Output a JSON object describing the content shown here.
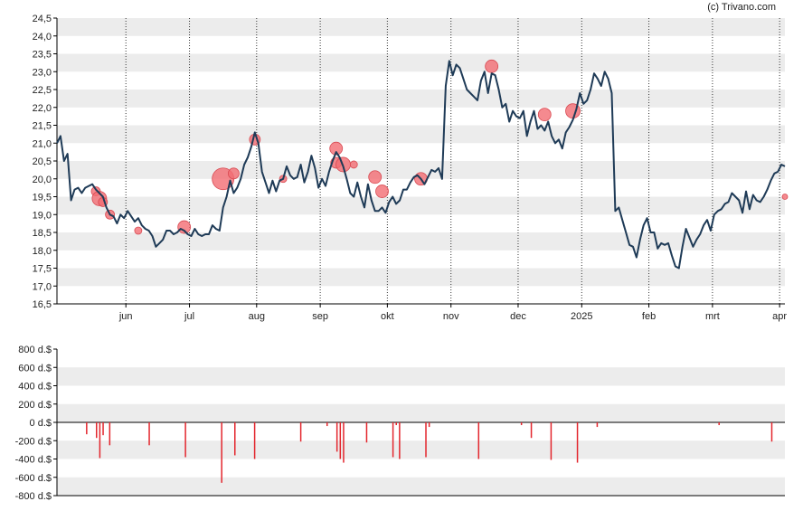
{
  "credit": "(c) Trivano.com",
  "colors": {
    "price_line": "#1f3b57",
    "marker": "#f26d73",
    "volume_bar": "#e3262d",
    "band": "#ececec"
  },
  "chart_data": [
    {
      "type": "line",
      "title": "",
      "xlabel": "",
      "ylabel": "",
      "ylim": [
        16.5,
        24.5
      ],
      "ytick_labels": [
        "16,5",
        "17,0",
        "17,5",
        "18,0",
        "18,5",
        "19,0",
        "19,5",
        "20,0",
        "20,5",
        "21,0",
        "21,5",
        "22,0",
        "22,5",
        "23,0",
        "23,5",
        "24,0",
        "24,5"
      ],
      "x_tick_labels": [
        "jun",
        "jul",
        "aug",
        "sep",
        "okt",
        "nov",
        "dec",
        "2025",
        "feb",
        "mrt",
        "apr"
      ],
      "series": [
        {
          "name": "",
          "x_unit": "trading day index",
          "points": [
            [
              0,
              21.0
            ],
            [
              1,
              21.2
            ],
            [
              2,
              20.5
            ],
            [
              3,
              20.7
            ],
            [
              4,
              19.4
            ],
            [
              5,
              19.7
            ],
            [
              6,
              19.75
            ],
            [
              7,
              19.6
            ],
            [
              8,
              19.75
            ],
            [
              9,
              19.8
            ],
            [
              10,
              19.85
            ],
            [
              11,
              19.7
            ],
            [
              12,
              19.6
            ],
            [
              13,
              19.5
            ],
            [
              14,
              19.2
            ],
            [
              15,
              19.0
            ],
            [
              16,
              18.95
            ],
            [
              17,
              18.75
            ],
            [
              18,
              19.0
            ],
            [
              19,
              18.9
            ],
            [
              20,
              19.1
            ],
            [
              21,
              18.95
            ],
            [
              22,
              18.8
            ],
            [
              23,
              18.9
            ],
            [
              24,
              18.7
            ],
            [
              25,
              18.6
            ],
            [
              26,
              18.55
            ],
            [
              27,
              18.4
            ],
            [
              28,
              18.1
            ],
            [
              29,
              18.2
            ],
            [
              30,
              18.3
            ],
            [
              31,
              18.55
            ],
            [
              32,
              18.55
            ],
            [
              33,
              18.45
            ],
            [
              34,
              18.5
            ],
            [
              35,
              18.6
            ],
            [
              36,
              18.55
            ],
            [
              37,
              18.45
            ],
            [
              38,
              18.4
            ],
            [
              39,
              18.6
            ],
            [
              40,
              18.45
            ],
            [
              41,
              18.4
            ],
            [
              42,
              18.45
            ],
            [
              43,
              18.45
            ],
            [
              44,
              18.7
            ],
            [
              45,
              18.6
            ],
            [
              46,
              18.55
            ],
            [
              47,
              19.2
            ],
            [
              48,
              19.5
            ],
            [
              49,
              19.95
            ],
            [
              50,
              19.6
            ],
            [
              51,
              19.75
            ],
            [
              52,
              20.0
            ],
            [
              53,
              20.4
            ],
            [
              54,
              20.6
            ],
            [
              55,
              20.9
            ],
            [
              56,
              21.3
            ],
            [
              57,
              21.0
            ],
            [
              58,
              20.2
            ],
            [
              59,
              19.9
            ],
            [
              60,
              19.6
            ],
            [
              61,
              19.95
            ],
            [
              62,
              19.65
            ],
            [
              63,
              19.95
            ],
            [
              64,
              20.0
            ],
            [
              65,
              20.35
            ],
            [
              66,
              20.1
            ],
            [
              67,
              20.0
            ],
            [
              68,
              20.05
            ],
            [
              69,
              20.4
            ],
            [
              70,
              19.9
            ],
            [
              71,
              20.2
            ],
            [
              72,
              20.65
            ],
            [
              73,
              20.3
            ],
            [
              74,
              19.75
            ],
            [
              75,
              20.0
            ],
            [
              76,
              19.8
            ],
            [
              77,
              20.2
            ],
            [
              78,
              20.5
            ],
            [
              79,
              20.75
            ],
            [
              80,
              20.6
            ],
            [
              81,
              20.35
            ],
            [
              82,
              20.0
            ],
            [
              83,
              19.6
            ],
            [
              84,
              19.5
            ],
            [
              85,
              19.9
            ],
            [
              86,
              19.5
            ],
            [
              87,
              19.2
            ],
            [
              88,
              19.85
            ],
            [
              89,
              19.4
            ],
            [
              90,
              19.1
            ],
            [
              91,
              19.1
            ],
            [
              92,
              19.2
            ],
            [
              93,
              19.05
            ],
            [
              94,
              19.35
            ],
            [
              95,
              19.5
            ],
            [
              96,
              19.3
            ],
            [
              97,
              19.4
            ],
            [
              98,
              19.7
            ],
            [
              99,
              19.7
            ],
            [
              100,
              19.9
            ],
            [
              101,
              20.05
            ],
            [
              102,
              20.1
            ],
            [
              103,
              20.0
            ],
            [
              104,
              19.85
            ],
            [
              105,
              20.05
            ],
            [
              106,
              20.25
            ],
            [
              107,
              20.2
            ],
            [
              108,
              20.3
            ],
            [
              109,
              20.0
            ],
            [
              110,
              22.6
            ],
            [
              111,
              23.3
            ],
            [
              112,
              22.9
            ],
            [
              113,
              23.2
            ],
            [
              114,
              23.1
            ],
            [
              115,
              22.8
            ],
            [
              116,
              22.5
            ],
            [
              117,
              22.4
            ],
            [
              118,
              22.3
            ],
            [
              119,
              22.2
            ],
            [
              120,
              22.75
            ],
            [
              121,
              23.0
            ],
            [
              122,
              22.4
            ],
            [
              123,
              22.95
            ],
            [
              124,
              22.9
            ],
            [
              125,
              22.5
            ],
            [
              126,
              22.0
            ],
            [
              127,
              22.1
            ],
            [
              128,
              21.6
            ],
            [
              129,
              21.9
            ],
            [
              130,
              21.75
            ],
            [
              131,
              21.7
            ],
            [
              132,
              21.9
            ],
            [
              133,
              21.2
            ],
            [
              134,
              21.6
            ],
            [
              135,
              21.9
            ],
            [
              136,
              21.4
            ],
            [
              137,
              21.5
            ],
            [
              138,
              21.35
            ],
            [
              139,
              21.6
            ],
            [
              140,
              21.2
            ],
            [
              141,
              21.0
            ],
            [
              142,
              21.1
            ],
            [
              143,
              20.85
            ],
            [
              144,
              21.3
            ],
            [
              145,
              21.45
            ],
            [
              146,
              21.65
            ],
            [
              147,
              21.95
            ],
            [
              148,
              22.4
            ],
            [
              149,
              22.1
            ],
            [
              150,
              22.2
            ],
            [
              151,
              22.5
            ],
            [
              152,
              22.95
            ],
            [
              153,
              22.8
            ],
            [
              154,
              22.6
            ],
            [
              155,
              23.0
            ],
            [
              156,
              22.8
            ],
            [
              157,
              22.4
            ],
            [
              158,
              19.1
            ],
            [
              159,
              19.2
            ],
            [
              160,
              18.85
            ],
            [
              161,
              18.5
            ],
            [
              162,
              18.15
            ],
            [
              163,
              18.1
            ],
            [
              164,
              17.8
            ],
            [
              165,
              18.3
            ],
            [
              166,
              18.7
            ],
            [
              167,
              18.9
            ],
            [
              168,
              18.5
            ],
            [
              169,
              18.5
            ],
            [
              170,
              18.05
            ],
            [
              171,
              18.2
            ],
            [
              172,
              18.15
            ],
            [
              173,
              18.2
            ],
            [
              174,
              17.85
            ],
            [
              175,
              17.55
            ],
            [
              176,
              17.5
            ],
            [
              177,
              18.1
            ],
            [
              178,
              18.6
            ],
            [
              179,
              18.35
            ],
            [
              180,
              18.1
            ],
            [
              181,
              18.3
            ],
            [
              182,
              18.45
            ],
            [
              183,
              18.7
            ],
            [
              184,
              18.85
            ],
            [
              185,
              18.55
            ],
            [
              186,
              19.0
            ],
            [
              187,
              19.1
            ],
            [
              188,
              19.15
            ],
            [
              189,
              19.3
            ],
            [
              190,
              19.35
            ],
            [
              191,
              19.6
            ],
            [
              192,
              19.5
            ],
            [
              193,
              19.4
            ],
            [
              194,
              19.05
            ],
            [
              195,
              19.65
            ],
            [
              196,
              19.15
            ],
            [
              197,
              19.55
            ],
            [
              198,
              19.4
            ],
            [
              199,
              19.35
            ],
            [
              200,
              19.5
            ],
            [
              201,
              19.7
            ],
            [
              202,
              19.95
            ],
            [
              203,
              20.15
            ],
            [
              204,
              20.2
            ],
            [
              205,
              20.4
            ],
            [
              206,
              20.35
            ]
          ]
        }
      ],
      "markers": [
        [
          11,
          19.65,
          5
        ],
        [
          12,
          19.45,
          8
        ],
        [
          13,
          19.35,
          5
        ],
        [
          15,
          19.0,
          5
        ],
        [
          23,
          18.55,
          4
        ],
        [
          36,
          18.65,
          7
        ],
        [
          47,
          20.0,
          12
        ],
        [
          50,
          20.15,
          6
        ],
        [
          56,
          21.1,
          6
        ],
        [
          64,
          20.0,
          4
        ],
        [
          79,
          20.85,
          7
        ],
        [
          79,
          20.45,
          6
        ],
        [
          81,
          20.4,
          8
        ],
        [
          84,
          20.4,
          4
        ],
        [
          90,
          20.05,
          7
        ],
        [
          92,
          19.65,
          7
        ],
        [
          103,
          20.0,
          7
        ],
        [
          123,
          23.15,
          7
        ],
        [
          138,
          21.8,
          7
        ],
        [
          146,
          21.9,
          8
        ],
        [
          206,
          19.5,
          3
        ]
      ],
      "month_boundaries": [
        19.5,
        37.5,
        56.5,
        74.5,
        93.5,
        111.5,
        130.5,
        148.5,
        167.5,
        185.5,
        204.5
      ],
      "x_count": 207
    },
    {
      "type": "bar",
      "title": "",
      "xlabel": "",
      "ylabel": "",
      "ylim": [
        -800,
        800
      ],
      "ytick_labels": [
        "800 d.$",
        "600 d.$",
        "400 d.$",
        "200 d.$",
        "0 d.$",
        "-200 d.$",
        "-400 d.$",
        "-600 d.$",
        "-800 d.$"
      ],
      "bars": [
        [
          9,
          -130
        ],
        [
          12,
          -170
        ],
        [
          13,
          -390
        ],
        [
          14,
          -140
        ],
        [
          16,
          -250
        ],
        [
          28,
          -250
        ],
        [
          39,
          -380
        ],
        [
          50,
          -660
        ],
        [
          54,
          -360
        ],
        [
          60,
          -400
        ],
        [
          74,
          -210
        ],
        [
          82,
          -40
        ],
        [
          85,
          -320
        ],
        [
          86,
          -400
        ],
        [
          87,
          -440
        ],
        [
          94,
          -220
        ],
        [
          102,
          -380
        ],
        [
          103,
          -30
        ],
        [
          104,
          -400
        ],
        [
          112,
          -380
        ],
        [
          113,
          -50
        ],
        [
          128,
          -400
        ],
        [
          141,
          -30
        ],
        [
          144,
          -170
        ],
        [
          150,
          -410
        ],
        [
          158,
          -440
        ],
        [
          164,
          -50
        ],
        [
          201,
          -30
        ],
        [
          217,
          -210
        ]
      ],
      "x_count": 222
    }
  ]
}
